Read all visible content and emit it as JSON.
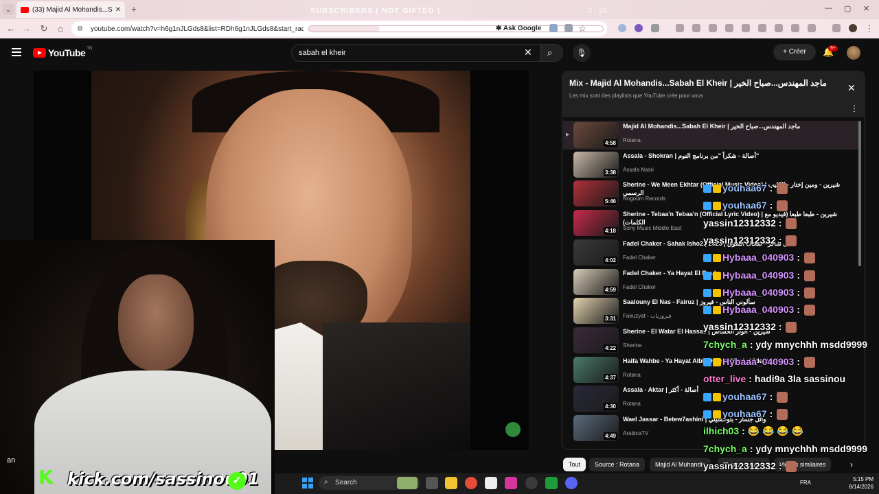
{
  "browser": {
    "tab_title": "(33) Majid Al Mohandis...Sabah",
    "url": "youtube.com/watch?v=h6g1nJLGds8&list=RDh6g1nJLGds8&start_radio=1",
    "ask_google": "Ask Google"
  },
  "stream_overlay": {
    "title": "SUBSCRIBERS ( NOT GIFTED )",
    "count": "0 · 25",
    "kick_url": "kick.com/sassinou01",
    "partial_name": "an"
  },
  "youtube": {
    "logo_text": "YouTube",
    "logo_region": "TN",
    "search_value": "sabah el kheir",
    "create_label": "Créer",
    "notification_badge": "9+"
  },
  "playlist": {
    "title": "Mix - Majid Al Mohandis...Sabah El Kheir | ماجد المهندس...صباح الخير",
    "subtitle": "Les mix sont des playlists que YouTube crée pour vous",
    "items": [
      {
        "title": "Majid Al Mohandis...Sabah El Kheir | ماجد المهندس...صباح الخير",
        "channel": "Rotana",
        "duration": "4:58"
      },
      {
        "title": "Assala - Shokran | أصالة - شكراً \"من برنامج النوم\"",
        "channel": "Assala Nasri",
        "duration": "3:38"
      },
      {
        "title": "Sherine - We Meen Ekhtar (Official Music Video) | شيرين - ومين إختار - الكليب الرسمي",
        "channel": "Nogoum Records",
        "duration": "5:46"
      },
      {
        "title": "Sherine - Tebaa'n Tebaa'n (Official Lyric Video) | شيرين - طبعا طبعا (فيديو مع الكلمات)",
        "channel": "Sony Music Middle East",
        "duration": "4:18"
      },
      {
        "title": "Fadel Chaker - Sahak Isho2 | 2025 | فضل شاكر - صحاك الشوق",
        "channel": "Fadel Chaker",
        "duration": "4:02"
      },
      {
        "title": "Fadel Chaker - Ya Hayat El Rouh",
        "channel": "Fadel Chaker",
        "duration": "4:59"
      },
      {
        "title": "Saalouny El Nas - Fairuz | سألوني الناس - فيروز",
        "channel": "Fairuzyat - فيروزيات",
        "duration": "3:31"
      },
      {
        "title": "Sherine - El Watar El Hassas | شيرين - الوتر الحساس",
        "channel": "Sherine",
        "duration": "4:22"
      },
      {
        "title": "Haifa Wahbe - Ya Hayat Albi (Official Music Video) | هيفاء",
        "channel": "Rotana",
        "duration": "4:37"
      },
      {
        "title": "Assala - Aktar | أصالة - أكثر",
        "channel": "Rotana",
        "duration": "4:30"
      },
      {
        "title": "Wael Jassar - Betew7ashini | وائل جسار - بتوحشيني",
        "channel": "ArabicaTV",
        "duration": "4:49"
      }
    ]
  },
  "chips": [
    "Tout",
    "Source : Rotana",
    "Majid Al Muhandis",
    "Musique arabe",
    "Vidéos similaires"
  ],
  "chat": [
    {
      "user": "youhaa67",
      "msg": "",
      "color": "#9ec3ff",
      "badges": true,
      "emote": true
    },
    {
      "user": "youhaa67",
      "msg": "",
      "color": "#9ec3ff",
      "badges": true,
      "emote": true
    },
    {
      "user": "yassin12312332",
      "msg": "",
      "color": "#ffffff",
      "badges": false,
      "emote": true
    },
    {
      "user": "yassin12312332",
      "msg": "",
      "color": "#ffffff",
      "badges": false,
      "emote": true
    },
    {
      "user": "Hybaaa_040903",
      "msg": "",
      "color": "#d795ff",
      "badges": true,
      "emote": true
    },
    {
      "user": "Hybaaa_040903",
      "msg": "",
      "color": "#d795ff",
      "badges": true,
      "emote": true
    },
    {
      "user": "Hybaaa_040903",
      "msg": "",
      "color": "#d795ff",
      "badges": true,
      "emote": true
    },
    {
      "user": "Hybaaa_040903",
      "msg": "",
      "color": "#d795ff",
      "badges": true,
      "emote": true
    },
    {
      "user": "yassin12312332",
      "msg": "",
      "color": "#ffffff",
      "badges": false,
      "emote": true
    },
    {
      "user": "7chych_a",
      "msg": "ydy mnychhh msdd9999",
      "color": "#7cff6b",
      "badges": false,
      "emote": false
    },
    {
      "user": "Hybaaa_040903",
      "msg": "",
      "color": "#d795ff",
      "badges": true,
      "emote": true
    },
    {
      "user": "otter_live",
      "msg": "hadi9a 3la sassinou",
      "color": "#ff7cd6",
      "badges": false,
      "emote": false
    },
    {
      "user": "youhaa67",
      "msg": "",
      "color": "#9ec3ff",
      "badges": true,
      "emote": true
    },
    {
      "user": "youhaa67",
      "msg": "",
      "color": "#9ec3ff",
      "badges": true,
      "emote": true
    },
    {
      "user": "ilhich03",
      "msg": "😂 😂 😂 😂",
      "color": "#7cff6b",
      "badges": false,
      "emote": false
    },
    {
      "user": "7chych_a",
      "msg": "ydy mnychhh msdd9999",
      "color": "#7cff6b",
      "badges": false,
      "emote": false
    },
    {
      "user": "yassin12312332",
      "msg": "",
      "color": "#ffffff",
      "badges": false,
      "emote": true
    },
    {
      "user": "yassin12312332",
      "msg": "",
      "color": "#ffffff",
      "badges": false,
      "emote": true
    }
  ],
  "taskbar": {
    "search_label": "Search",
    "lang": "FRA",
    "time": "5:15 PM",
    "date": "8/14/2026"
  }
}
